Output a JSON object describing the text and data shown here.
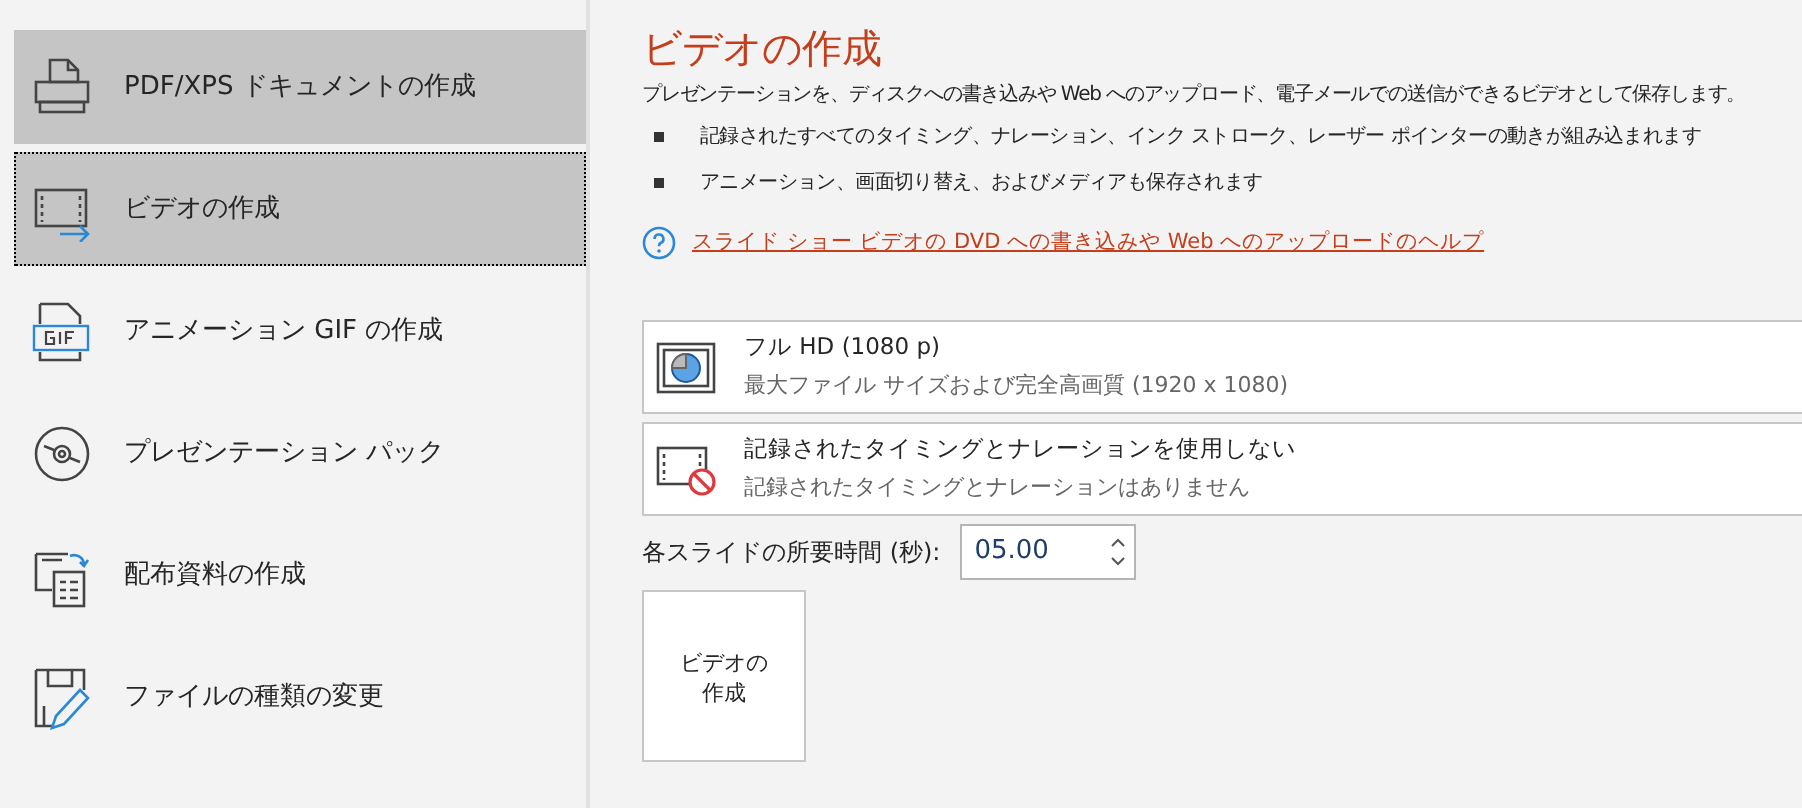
{
  "sidebar": {
    "items": [
      {
        "label": "PDF/XPS ドキュメントの作成",
        "highlighted": true,
        "selected": false
      },
      {
        "label": "ビデオの作成",
        "highlighted": true,
        "selected": true
      },
      {
        "label": "アニメーション GIF の作成",
        "highlighted": false,
        "selected": false
      },
      {
        "label": "プレゼンテーション パック",
        "highlighted": false,
        "selected": false
      },
      {
        "label": "配布資料の作成",
        "highlighted": false,
        "selected": false
      },
      {
        "label": "ファイルの種類の変更",
        "highlighted": false,
        "selected": false
      }
    ]
  },
  "content": {
    "title": "ビデオの作成",
    "description": "プレゼンテーションを、ディスクへの書き込みや Web へのアップロード、電子メールでの送信ができるビデオとして保存します。",
    "bullets": [
      "記録されたすべてのタイミング、ナレーション、インク ストローク、レーザー ポインターの動きが組み込まれます",
      "アニメーション、画面切り替え、およびメディアも保存されます"
    ],
    "help_link": "スライド ショー ビデオの DVD への書き込みや Web へのアップロードのヘルプ",
    "dropdowns": [
      {
        "title": "フル HD (1080 p)",
        "subtitle": "最大ファイル サイズおよび完全高画質 (1920 x 1080)"
      },
      {
        "title": "記録されたタイミングとナレーションを使用しない",
        "subtitle": "記録されたタイミングとナレーションはありません"
      }
    ],
    "duration": {
      "label": "各スライドの所要時間 (秒):",
      "value": "05.00"
    },
    "create_button": {
      "label_lines": [
        "ビデオの",
        "作成"
      ]
    }
  }
}
